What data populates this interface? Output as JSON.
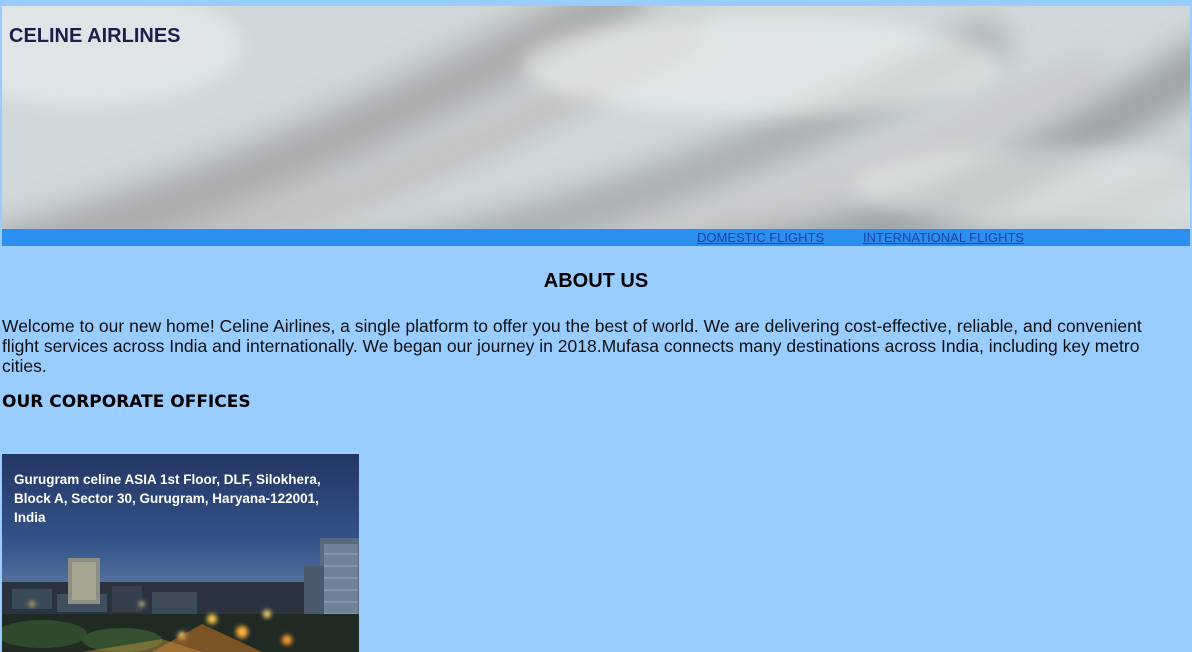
{
  "header": {
    "brand": "CELINE AIRLINES"
  },
  "nav": {
    "domestic": "DOMESTIC FLIGHTS",
    "international": "INTERNATIONAL FLIGHTS"
  },
  "about": {
    "title": "ABOUT US",
    "text": "Welcome to our new home! Celine Airlines, a single platform to offer you the best of world. We are delivering cost-effective, reliable, and convenient flight services across India and internationally. We began our journey in 2018.Mufasa connects many destinations across India, including key metro cities."
  },
  "offices": {
    "title": "OUR CORPORATE OFFICES",
    "cards": [
      {
        "address": "Gurugram celine ASIA 1st Floor, DLF, Silokhera, Block A, Sector 30, Gurugram, Haryana-122001, India"
      }
    ]
  },
  "colors": {
    "page_background": "#99ccff",
    "navbar": "#2b8ff0",
    "brand_text": "#1a1f4d",
    "nav_link": "#1f3fa8"
  }
}
